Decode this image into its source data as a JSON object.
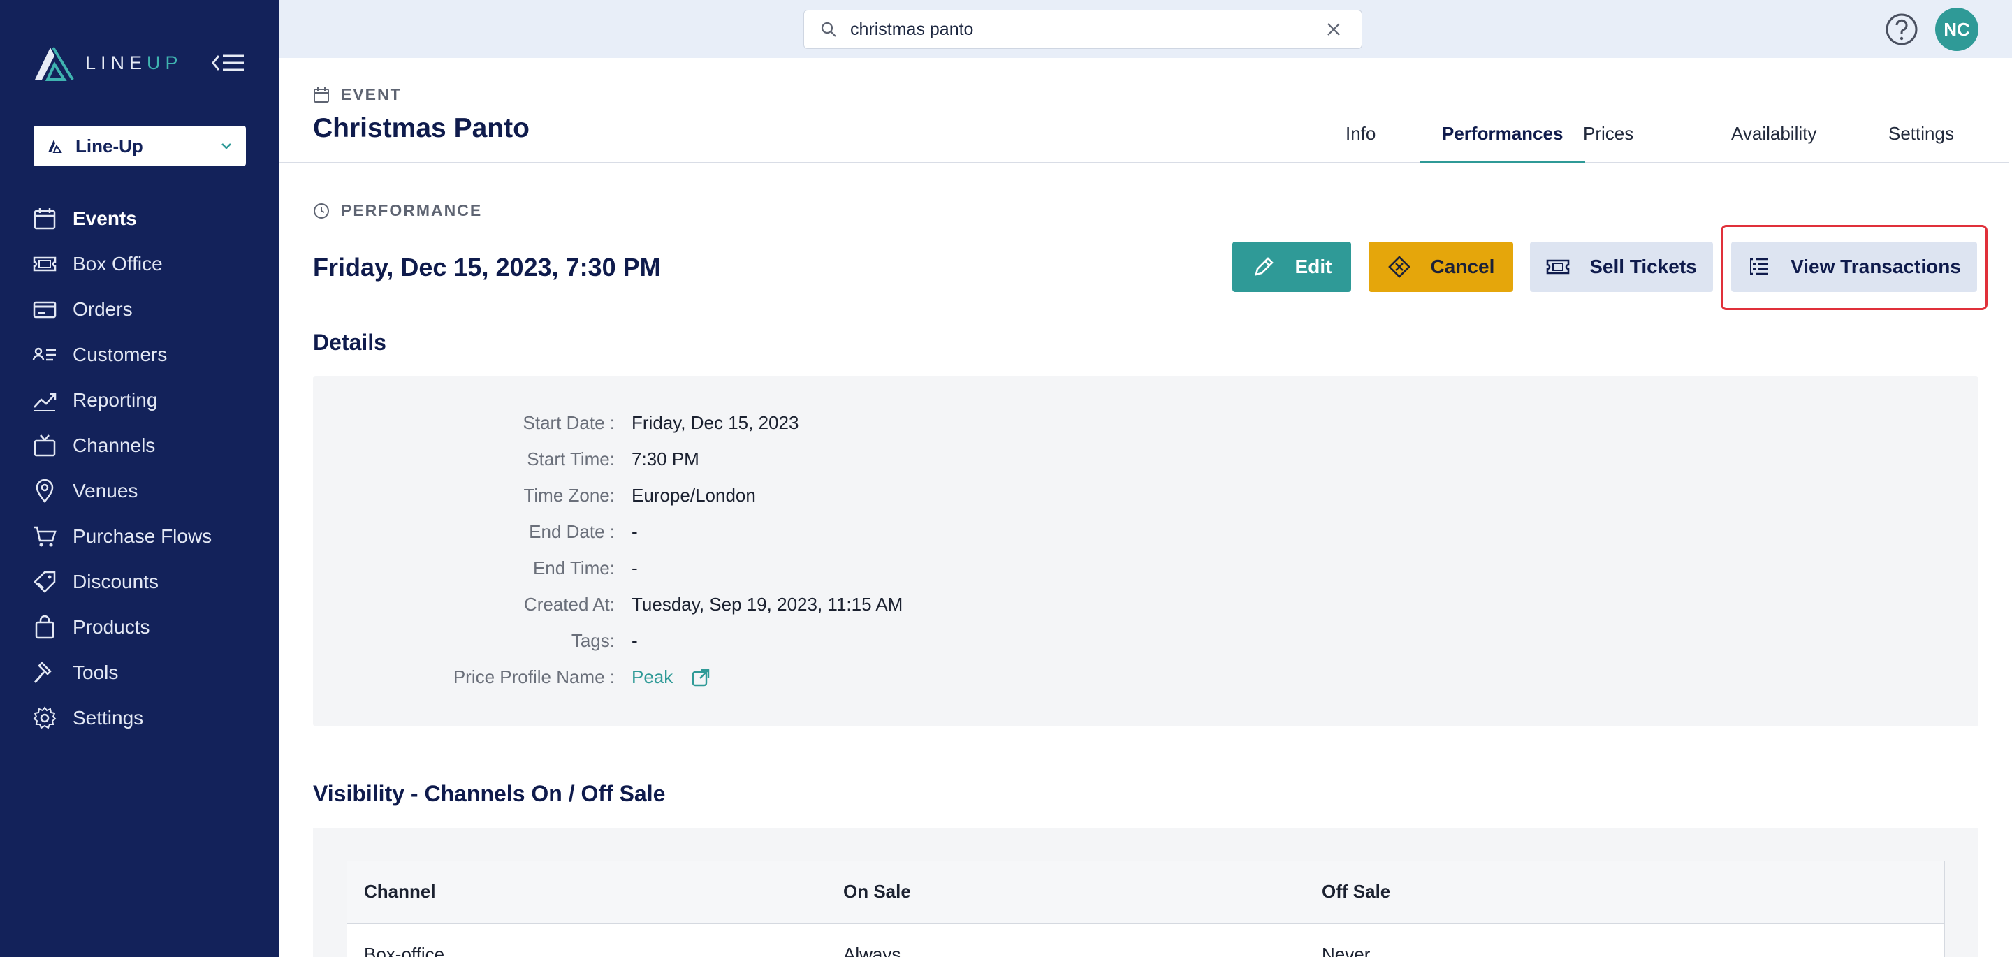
{
  "sidebar": {
    "logo_text_a": "LINE",
    "logo_text_b": "UP",
    "org_selector": {
      "value": "Line-Up"
    },
    "items": [
      {
        "label": "Events",
        "icon": "calendar-icon",
        "active": true
      },
      {
        "label": "Box Office",
        "icon": "ticket-icon"
      },
      {
        "label": "Orders",
        "icon": "credit-card-icon"
      },
      {
        "label": "Customers",
        "icon": "contacts-icon"
      },
      {
        "label": "Reporting",
        "icon": "chart-line-icon"
      },
      {
        "label": "Channels",
        "icon": "tv-icon"
      },
      {
        "label": "Venues",
        "icon": "map-pin-icon"
      },
      {
        "label": "Purchase Flows",
        "icon": "cart-icon"
      },
      {
        "label": "Discounts",
        "icon": "tag-icon"
      },
      {
        "label": "Products",
        "icon": "shopping-bag-icon"
      },
      {
        "label": "Tools",
        "icon": "hammer-icon"
      },
      {
        "label": "Settings",
        "icon": "gear-icon"
      }
    ]
  },
  "topbar": {
    "search": {
      "value": "christmas panto",
      "placeholder": ""
    },
    "avatar_initials": "NC"
  },
  "event": {
    "label": "EVENT",
    "title": "Christmas Panto",
    "tabs": [
      {
        "label": "Info"
      },
      {
        "label": "Performances",
        "active": true
      },
      {
        "label": "Prices"
      },
      {
        "label": "Availability"
      },
      {
        "label": "Settings"
      }
    ]
  },
  "performance": {
    "label": "PERFORMANCE",
    "title": "Friday, Dec 15, 2023, 7:30 PM",
    "actions": {
      "edit": "Edit",
      "cancel": "Cancel",
      "sell": "Sell Tickets",
      "view_transactions": "View Transactions"
    }
  },
  "details": {
    "title": "Details",
    "rows": [
      {
        "label": "Start Date :",
        "value": "Friday, Dec 15, 2023"
      },
      {
        "label": "Start Time:",
        "value": "7:30 PM"
      },
      {
        "label": "Time Zone:",
        "value": "Europe/London"
      },
      {
        "label": "End Date :",
        "value": "-"
      },
      {
        "label": "End Time:",
        "value": "-"
      },
      {
        "label": "Created At:",
        "value": "Tuesday, Sep 19, 2023, 11:15 AM"
      },
      {
        "label": "Tags:",
        "value": "-"
      },
      {
        "label": "Price Profile Name :",
        "value": "Peak"
      }
    ]
  },
  "visibility": {
    "title": "Visibility - Channels On / Off Sale",
    "columns": [
      "Channel",
      "On Sale",
      "Off Sale"
    ],
    "rows": [
      [
        "Box-office",
        "Always",
        "Never"
      ]
    ]
  },
  "colors": {
    "sidebar_bg": "#13225a",
    "accent_teal": "#2f9a97",
    "cancel_amber": "#e5a60b",
    "highlight_red": "#e0303a"
  }
}
